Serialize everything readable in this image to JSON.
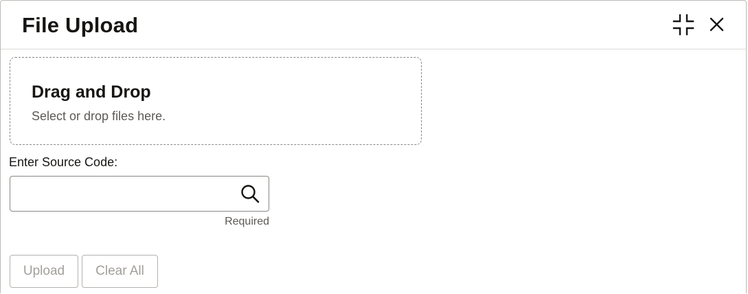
{
  "dialog": {
    "title": "File Upload",
    "header_icons": [
      "compress-icon",
      "close-icon"
    ]
  },
  "dropzone": {
    "title": "Drag and Drop",
    "subtitle": "Select or drop files here."
  },
  "source_code": {
    "label": "Enter Source Code:",
    "value": "",
    "placeholder": "",
    "hint": "Required",
    "icon": "search-icon"
  },
  "actions": {
    "upload_label": "Upload",
    "clear_label": "Clear All"
  },
  "colors": {
    "text": "#161513",
    "muted": "#5c5955",
    "disabled_text": "#a29f9b",
    "border": "#8a8783"
  }
}
